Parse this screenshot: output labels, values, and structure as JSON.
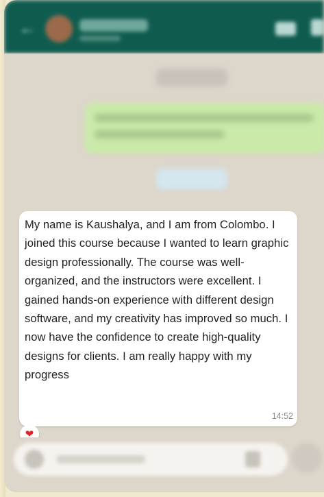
{
  "message": {
    "text": "My name is Kaushalya, and I am from Colombo. I joined this course because I wanted to learn graphic design professionally. The course was well-organized, and the instructors were excellent. I gained hands-on experience with different design software, and my creativity has improved so much. I now have the confidence to create high-quality designs for clients. I am really happy with my progress",
    "time": "14:52",
    "reaction": "❤"
  },
  "colors": {
    "header": "#0f5c4f",
    "chat_background": "#ddd6cb",
    "incoming_bubble": "#ffffff",
    "outgoing_bubble": "#c9eaa8",
    "reaction_heart": "#e0242e"
  },
  "icons": {
    "back": "arrow-left-icon",
    "video": "video-call-icon",
    "call": "phone-icon",
    "emoji": "emoji-icon",
    "attach": "paperclip-icon",
    "mic": "mic-icon"
  }
}
